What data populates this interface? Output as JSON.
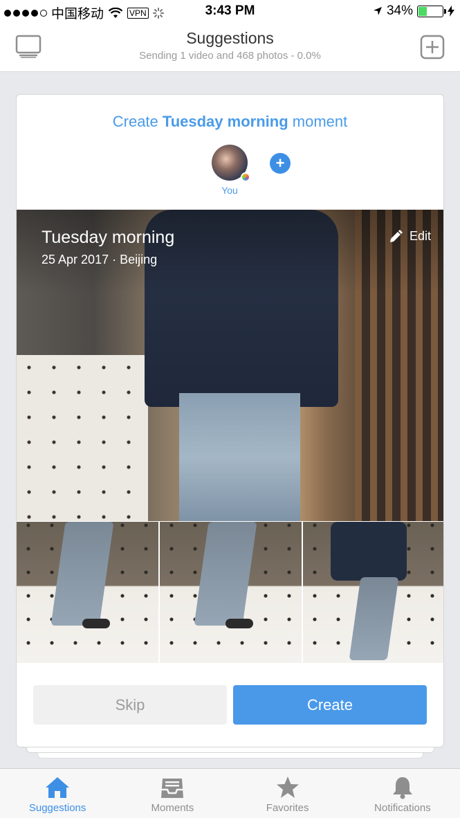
{
  "status_bar": {
    "carrier": "中国移动",
    "vpn": "VPN",
    "time": "3:43 PM",
    "battery": "34%",
    "battery_level": 0.34
  },
  "header": {
    "title": "Suggestions",
    "subtitle": "Sending 1 video and 468 photos - 0.0%",
    "left_icon": "device-monitor-icon",
    "right_icon": "add-square-icon"
  },
  "card": {
    "headline_prefix": "Create ",
    "headline_bold": "Tuesday morning",
    "headline_suffix": " moment",
    "person_label": "You",
    "add_person": "+",
    "hero": {
      "title": "Tuesday morning",
      "subtitle": "25 Apr 2017 · Beijing",
      "edit_label": "Edit"
    },
    "skip_label": "Skip",
    "create_label": "Create"
  },
  "tabs": [
    {
      "label": "Suggestions",
      "icon": "home-icon",
      "active": true
    },
    {
      "label": "Moments",
      "icon": "inbox-icon",
      "active": false
    },
    {
      "label": "Favorites",
      "icon": "star-icon",
      "active": false
    },
    {
      "label": "Notifications",
      "icon": "bell-icon",
      "active": false
    }
  ],
  "colors": {
    "accent": "#4a99e9",
    "background": "#e8e9ec"
  }
}
